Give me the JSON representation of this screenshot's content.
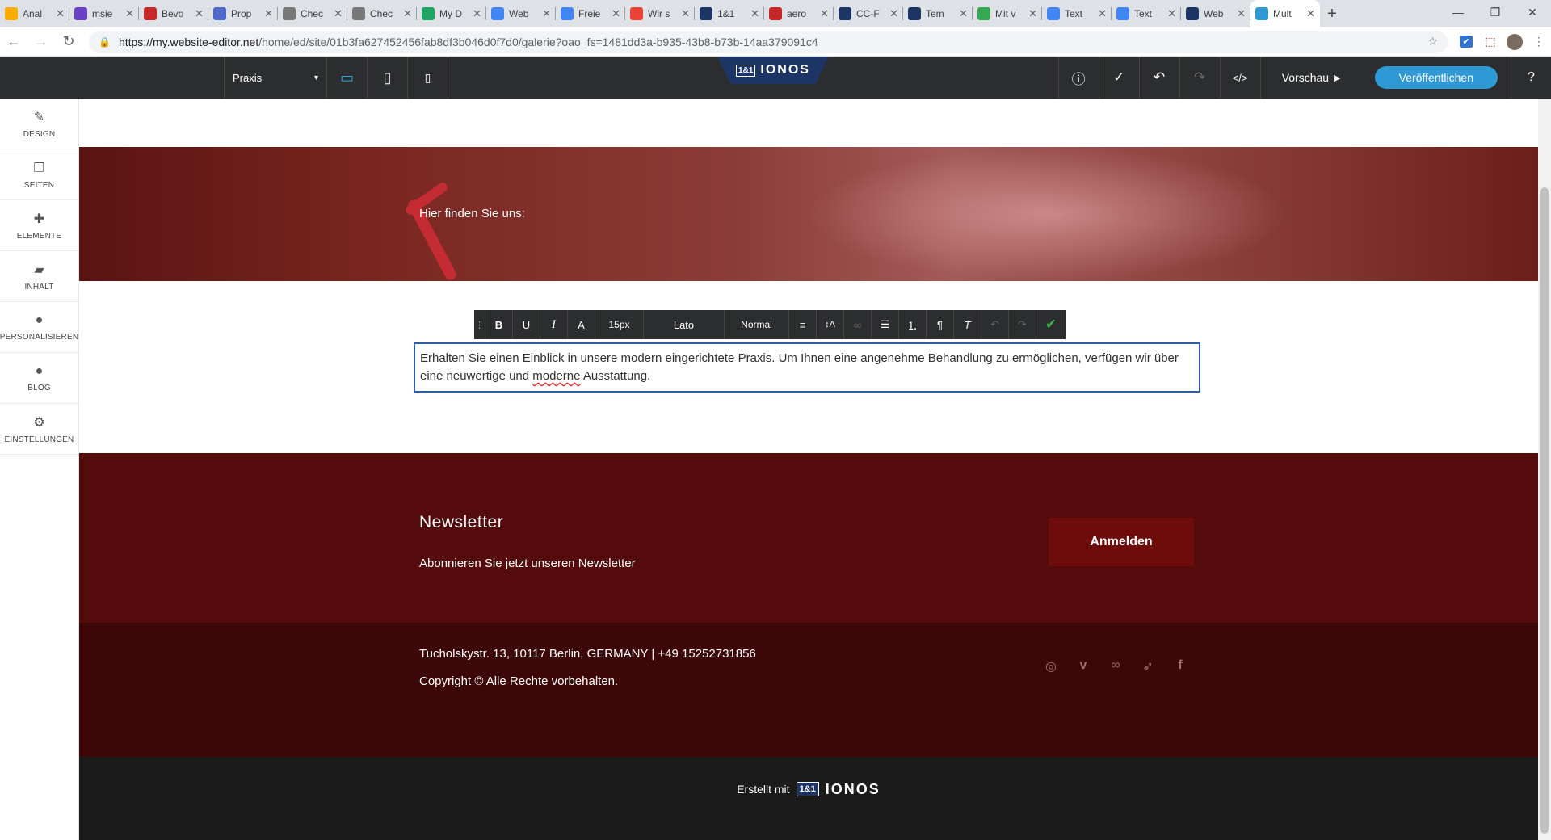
{
  "browser": {
    "tabs": [
      {
        "title": "Anal",
        "icon": "chart-favicon",
        "color": "#f9ab00"
      },
      {
        "title": "msie",
        "icon": "mail-favicon",
        "color": "#6a40c4"
      },
      {
        "title": "Bevo",
        "icon": "z-favicon",
        "color": "#c62828"
      },
      {
        "title": "Prop",
        "icon": "rk-favicon",
        "color": "#5068c8"
      },
      {
        "title": "Chec",
        "icon": "doc-favicon",
        "color": "#777777"
      },
      {
        "title": "Chec",
        "icon": "doc-favicon",
        "color": "#777777"
      },
      {
        "title": "My D",
        "icon": "drive-favicon",
        "color": "#1fa463"
      },
      {
        "title": "Web",
        "icon": "docs-favicon",
        "color": "#4285f4"
      },
      {
        "title": "Freie",
        "icon": "ads-favicon",
        "color": "#4285f4"
      },
      {
        "title": "Wir s",
        "icon": "maps-favicon",
        "color": "#ea4335"
      },
      {
        "title": "1&1",
        "icon": "ionos-favicon",
        "color": "#1d3565"
      },
      {
        "title": "aero",
        "icon": "red-favicon",
        "color": "#c62828"
      },
      {
        "title": "CC-F",
        "icon": "cc-favicon",
        "color": "#1d3565"
      },
      {
        "title": "Tem",
        "icon": "word-favicon",
        "color": "#1d3565"
      },
      {
        "title": "Mit v",
        "icon": "gmail-favicon",
        "color": "#34a853"
      },
      {
        "title": "Text",
        "icon": "docs-favicon",
        "color": "#4285f4"
      },
      {
        "title": "Text",
        "icon": "docs-favicon",
        "color": "#4285f4"
      },
      {
        "title": "Web",
        "icon": "word-favicon",
        "color": "#1d3565"
      },
      {
        "title": "Mult",
        "icon": "ionos-favicon",
        "color": "#2f99d6"
      }
    ],
    "url_main": "https://my.website-editor.net",
    "url_path": "/home/ed/site/01b3fa627452456fab8df3b046d0f7d0/galerie?oao_fs=1481dd3a-b935-43b8-b73b-14aa379091c4"
  },
  "editor": {
    "page_select": "Praxis",
    "logo_box": "1&1",
    "logo_text": "IONOS",
    "preview": "Vorschau",
    "publish": "Veröffentlichen"
  },
  "sidebar": {
    "items": [
      {
        "label": "DESIGN",
        "icon": "brush-icon",
        "glyph": "✎"
      },
      {
        "label": "SEITEN",
        "icon": "pages-icon",
        "glyph": "❐"
      },
      {
        "label": "ELEMENTE",
        "icon": "plus-icon",
        "glyph": "✚"
      },
      {
        "label": "INHALT",
        "icon": "folder-icon",
        "glyph": "▰"
      },
      {
        "label": "PERSONALISIEREN",
        "icon": "person-icon",
        "glyph": "●"
      },
      {
        "label": "BLOG",
        "icon": "comment-icon",
        "glyph": "●"
      },
      {
        "label": "EINSTELLUNGEN",
        "icon": "gear-icon",
        "glyph": "⚙"
      }
    ]
  },
  "toolbar": {
    "font_size": "15px",
    "font_family": "Lato",
    "style": "Normal"
  },
  "content": {
    "hero_text": "Hier finden Sie uns:",
    "paragraph_1": "Erhalten Sie einen Einblick in unsere modern eingerichtete Praxis. Um Ihnen eine angenehme Behandlung zu ermöglichen, verfügen wir über eine neuwertige und ",
    "paragraph_spell": "moderne",
    "paragraph_2": " Ausstattung.",
    "newsletter_title": "Newsletter",
    "newsletter_sub": "Abonnieren Sie jetzt unseren Newsletter",
    "newsletter_button": "Anmelden",
    "address": "Tucholskystr. 13, 10117 Berlin, GERMANY |  +49 15252731856",
    "copyright": "Copyright © Alle Rechte vorbehalten.",
    "made_with": "Erstellt mit",
    "made_logo_box": "1&1",
    "made_logo_text": "IONOS"
  }
}
